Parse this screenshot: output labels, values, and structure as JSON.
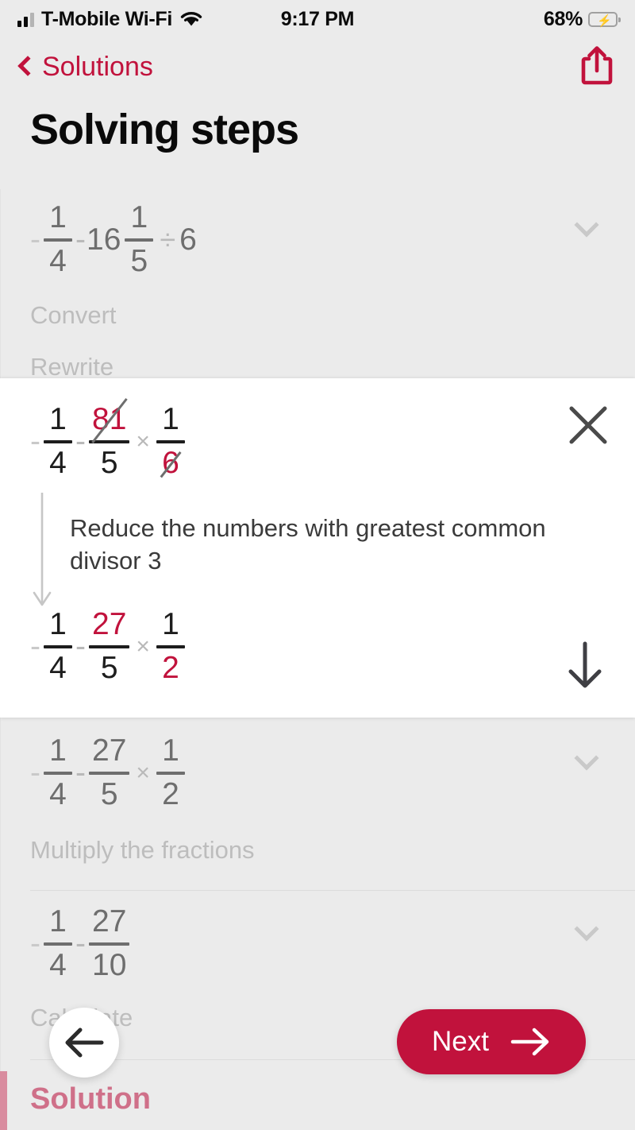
{
  "status_bar": {
    "carrier": "T-Mobile Wi-Fi",
    "time": "9:17 PM",
    "battery_percent": "68%",
    "signal_icon": "cellular-bars-icon",
    "wifi_icon": "wifi-icon",
    "battery_icon": "battery-charging-icon"
  },
  "nav": {
    "back_label": "Solutions",
    "back_icon": "chevron-left-icon",
    "share_icon": "share-icon",
    "accent_color": "#c1123c"
  },
  "page": {
    "title": "Solving steps"
  },
  "steps": [
    {
      "id": "step-convert-rewrite",
      "state": "collapsed",
      "expression": "- 1/4 - 16 1/5 ÷ 6",
      "caption_line1": "Convert",
      "caption_line2": "Rewrite",
      "chevron_icon": "chevron-down-icon",
      "parts": {
        "lead_minus": "-",
        "f1_num": "1",
        "f1_den": "4",
        "mid_minus": "-",
        "whole": "16",
        "f2_num": "1",
        "f2_den": "5",
        "divide": "÷",
        "divisor": "6"
      }
    },
    {
      "id": "step-multiply-fractions",
      "state": "collapsed",
      "expression": "- 1/4 - 27/5 × 1/2",
      "caption_line1": "Multiply the fractions",
      "chevron_icon": "chevron-down-icon",
      "parts": {
        "lead_minus": "-",
        "f1_num": "1",
        "f1_den": "4",
        "mid_minus": "-",
        "f2_num": "27",
        "f2_den": "5",
        "times": "×",
        "f3_num": "1",
        "f3_den": "2"
      }
    },
    {
      "id": "step-calculate",
      "state": "collapsed",
      "expression": "- 1/4 - 27/10",
      "caption_line1": "Calculate",
      "chevron_icon": "chevron-down-icon",
      "parts": {
        "lead_minus": "-",
        "f1_num": "1",
        "f1_den": "4",
        "mid_minus": "-",
        "f2_num": "27",
        "f2_den": "10"
      }
    }
  ],
  "active_card": {
    "id": "step-reduce-gcd",
    "state": "expanded",
    "close_icon": "close-icon",
    "down_icon": "arrow-down-icon",
    "connector_icon": "arrow-down-connector-icon",
    "explanation": "Reduce the numbers with greatest common divisor 3",
    "input_expression": "- 1/4 - 81/5 × 1/6",
    "output_expression": "- 1/4 - 27/5 × 1/2",
    "input_parts": {
      "lead_minus": "-",
      "f1_num": "1",
      "f1_den": "4",
      "mid_minus": "-",
      "f2_num": "81",
      "f2_num_struck": true,
      "f2_den": "5",
      "times": "×",
      "f3_num": "1",
      "f3_den": "6",
      "f3_den_struck": true
    },
    "output_parts": {
      "lead_minus": "-",
      "f1_num": "1",
      "f1_den": "4",
      "mid_minus": "-",
      "f2_num": "27",
      "f2_den": "5",
      "times": "×",
      "f3_num": "1",
      "f3_den": "2"
    },
    "highlight_color": "#c1123c"
  },
  "solution": {
    "label": "Solution",
    "state": "dimmed",
    "accent_color": "#cf7089"
  },
  "controls": {
    "back_button_icon": "arrow-left-icon",
    "next_label": "Next",
    "next_icon": "arrow-right-icon",
    "next_color": "#c1123c"
  }
}
